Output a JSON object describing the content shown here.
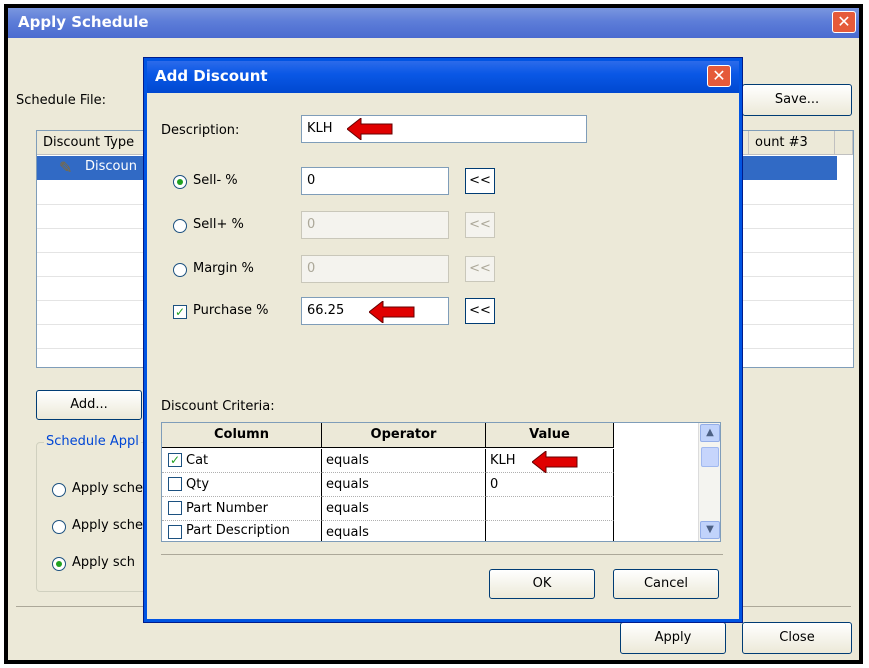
{
  "outer": {
    "title": "Apply Schedule",
    "schedule_file_label": "Schedule File:",
    "save_button": "Save...",
    "list_header_left": "Discount Type",
    "list_header_right": "ount #3",
    "list_row_label": "Discoun",
    "add_button": "Add...",
    "group_label": "Schedule Appl",
    "radio_options": [
      "Apply sche",
      "Apply sche",
      "Apply sch"
    ],
    "apply_button": "Apply",
    "close_button": "Close"
  },
  "dialog": {
    "title": "Add Discount",
    "description_label": "Description:",
    "description_value": "KLH",
    "fields": [
      {
        "label": "Sell- %",
        "value": "0",
        "selected": true,
        "enabled": true
      },
      {
        "label": "Sell+ %",
        "value": "0",
        "selected": false,
        "enabled": false
      },
      {
        "label": "Margin %",
        "value": "0",
        "selected": false,
        "enabled": false
      }
    ],
    "purchase": {
      "label": "Purchase %",
      "value": "66.25",
      "checked": true
    },
    "copy_button": "<<",
    "criteria_label": "Discount Criteria:",
    "grid": {
      "headers": [
        "Column",
        "Operator",
        "Value"
      ],
      "rows": [
        {
          "checked": true,
          "column": "Cat",
          "operator": "equals",
          "value": "KLH"
        },
        {
          "checked": false,
          "column": "Qty",
          "operator": "equals",
          "value": "0"
        },
        {
          "checked": false,
          "column": "Part Number",
          "operator": "equals",
          "value": ""
        },
        {
          "checked": false,
          "column": "Part Description",
          "operator": "equals",
          "value": ""
        }
      ]
    },
    "ok_button": "OK",
    "cancel_button": "Cancel"
  },
  "icons": {
    "close": "close-icon",
    "arrow": "red-arrow-icon",
    "scroll_up": "scroll-up-icon",
    "scroll_down": "scroll-down-icon"
  },
  "colors": {
    "dialog_title": "#0a58e6",
    "outer_title": "#5d7dd8",
    "selection": "#316ac5",
    "arrow": "#e00000"
  }
}
